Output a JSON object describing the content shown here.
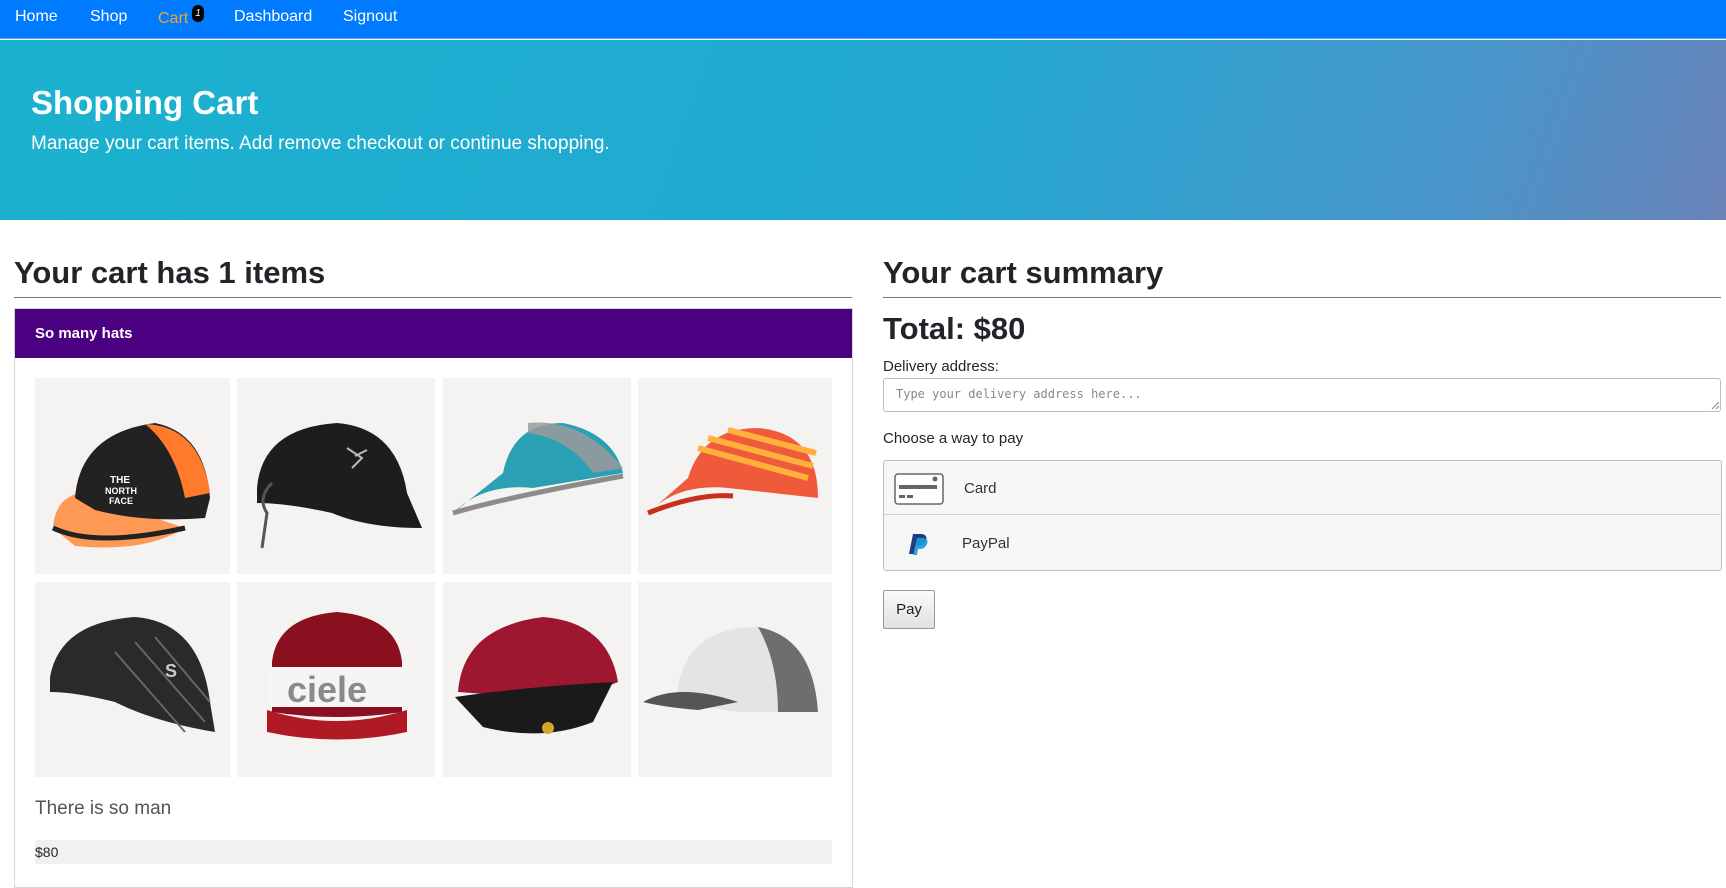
{
  "nav": {
    "items": [
      {
        "label": "Home"
      },
      {
        "label": "Shop"
      },
      {
        "label": "Cart"
      },
      {
        "label": "Dashboard"
      },
      {
        "label": "Signout"
      }
    ],
    "cart_badge": "1",
    "active_item": "Cart",
    "bar_color": "#007bff",
    "active_color": "#f5a623"
  },
  "jumbotron": {
    "title": "Shopping Cart",
    "subtitle": "Manage your cart items. Add remove checkout or continue shopping."
  },
  "cart": {
    "heading": "Your cart has 1 items",
    "item": {
      "name": "So many hats",
      "header_color": "#4b0082",
      "description": "There is so man",
      "price": "$80",
      "images": [
        "black-orange-cap-icon",
        "black-cap-icon",
        "teal-cap-icon",
        "red-orange-cap-icon",
        "black-mesh-cap-icon",
        "ciele-cap-icon",
        "maroon-cap-icon",
        "grey-cap-icon"
      ]
    }
  },
  "summary": {
    "heading": "Your cart summary",
    "total": "Total: $80",
    "address_label": "Delivery address:",
    "address_placeholder": "Type your delivery address here...",
    "pay_label": "Choose a way to pay",
    "methods": [
      {
        "label": "Card",
        "icon": "credit-card-icon"
      },
      {
        "label": "PayPal",
        "icon": "paypal-icon"
      }
    ],
    "pay_button": "Pay"
  }
}
